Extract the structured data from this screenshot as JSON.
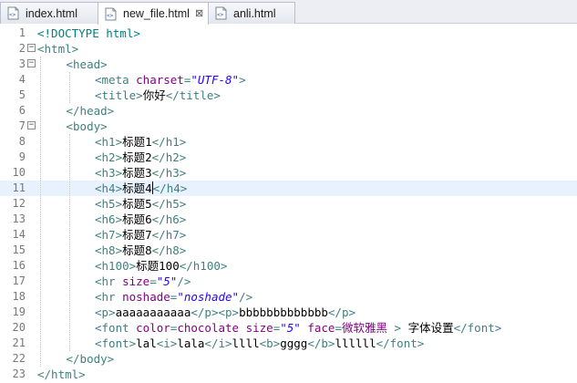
{
  "tabs": [
    {
      "label": "index.html",
      "active": false
    },
    {
      "label": "new_file.html",
      "active": true,
      "close": "⊠"
    },
    {
      "label": "anli.html",
      "active": false
    }
  ],
  "editor": {
    "current_line": 11,
    "lines": [
      {
        "n": "1",
        "indent": 0,
        "parts": [
          [
            "d",
            "<!DOCTYPE html>"
          ]
        ]
      },
      {
        "n": "2",
        "indent": 0,
        "fold": "−",
        "parts": [
          [
            "t",
            "<html>"
          ]
        ]
      },
      {
        "n": "3",
        "indent": 1,
        "fold": "−",
        "parts": [
          [
            "t",
            "<head>"
          ]
        ]
      },
      {
        "n": "4",
        "indent": 2,
        "parts": [
          [
            "t",
            "<meta "
          ],
          [
            "a",
            "charset"
          ],
          [
            "t",
            "="
          ],
          [
            "v",
            "\"UTF-8\""
          ],
          [
            "t",
            ">"
          ]
        ]
      },
      {
        "n": "5",
        "indent": 2,
        "parts": [
          [
            "t",
            "<title>"
          ],
          [
            "x",
            "你好"
          ],
          [
            "t",
            "</title>"
          ]
        ]
      },
      {
        "n": "6",
        "indent": 1,
        "parts": [
          [
            "t",
            "</head>"
          ]
        ]
      },
      {
        "n": "7",
        "indent": 1,
        "fold": "−",
        "parts": [
          [
            "t",
            "<body>"
          ]
        ]
      },
      {
        "n": "8",
        "indent": 2,
        "parts": [
          [
            "t",
            "<h1>"
          ],
          [
            "x",
            "标题1"
          ],
          [
            "t",
            "</h1>"
          ]
        ]
      },
      {
        "n": "9",
        "indent": 2,
        "parts": [
          [
            "t",
            "<h2>"
          ],
          [
            "x",
            "标题2"
          ],
          [
            "t",
            "</h2>"
          ]
        ]
      },
      {
        "n": "10",
        "indent": 2,
        "parts": [
          [
            "t",
            "<h3>"
          ],
          [
            "x",
            "标题3"
          ],
          [
            "t",
            "</h3>"
          ]
        ]
      },
      {
        "n": "11",
        "indent": 2,
        "caret_after": 1,
        "parts": [
          [
            "t",
            "<h4>"
          ],
          [
            "x",
            "标题4"
          ],
          [
            "t",
            "</h4>"
          ]
        ]
      },
      {
        "n": "12",
        "indent": 2,
        "parts": [
          [
            "t",
            "<h5>"
          ],
          [
            "x",
            "标题5"
          ],
          [
            "t",
            "</h5>"
          ]
        ]
      },
      {
        "n": "13",
        "indent": 2,
        "parts": [
          [
            "t",
            "<h6>"
          ],
          [
            "x",
            "标题6"
          ],
          [
            "t",
            "</h6>"
          ]
        ]
      },
      {
        "n": "14",
        "indent": 2,
        "parts": [
          [
            "t",
            "<h7>"
          ],
          [
            "x",
            "标题7"
          ],
          [
            "t",
            "</h7>"
          ]
        ]
      },
      {
        "n": "15",
        "indent": 2,
        "parts": [
          [
            "t",
            "<h8>"
          ],
          [
            "x",
            "标题8"
          ],
          [
            "t",
            "</h8>"
          ]
        ]
      },
      {
        "n": "16",
        "indent": 2,
        "parts": [
          [
            "t",
            "<h100>"
          ],
          [
            "x",
            "标题100"
          ],
          [
            "t",
            "</h100>"
          ]
        ]
      },
      {
        "n": "17",
        "indent": 2,
        "parts": [
          [
            "t",
            "<hr "
          ],
          [
            "a",
            "size"
          ],
          [
            "t",
            "="
          ],
          [
            "v",
            "\"5\""
          ],
          [
            "t",
            "/>"
          ]
        ]
      },
      {
        "n": "18",
        "indent": 2,
        "parts": [
          [
            "t",
            "<hr "
          ],
          [
            "a",
            "noshade"
          ],
          [
            "t",
            "="
          ],
          [
            "v",
            "\"noshade\""
          ],
          [
            "t",
            "/>"
          ]
        ]
      },
      {
        "n": "19",
        "indent": 2,
        "parts": [
          [
            "t",
            "<p>"
          ],
          [
            "x",
            "aaaaaaaaaaa"
          ],
          [
            "t",
            "</p><p>"
          ],
          [
            "x",
            "bbbbbbbbbbbbb"
          ],
          [
            "t",
            "</p>"
          ]
        ]
      },
      {
        "n": "20",
        "indent": 2,
        "parts": [
          [
            "t",
            "<font "
          ],
          [
            "a",
            "color"
          ],
          [
            "t",
            "="
          ],
          [
            "a",
            "chocolate"
          ],
          [
            "t",
            " "
          ],
          [
            "a",
            "size"
          ],
          [
            "t",
            "="
          ],
          [
            "v",
            "\"5\""
          ],
          [
            "t",
            " "
          ],
          [
            "a",
            "face"
          ],
          [
            "t",
            "="
          ],
          [
            "a",
            "微软雅黑"
          ],
          [
            "t",
            " > "
          ],
          [
            "x",
            "字体设置"
          ],
          [
            "t",
            "</font>"
          ]
        ]
      },
      {
        "n": "21",
        "indent": 2,
        "parts": [
          [
            "t",
            "<font>"
          ],
          [
            "x",
            "lal"
          ],
          [
            "t",
            "<i>"
          ],
          [
            "x",
            "lala"
          ],
          [
            "t",
            "</i>"
          ],
          [
            "x",
            "llll"
          ],
          [
            "t",
            "<b>"
          ],
          [
            "x",
            "gggg"
          ],
          [
            "t",
            "</b>"
          ],
          [
            "x",
            "llllll"
          ],
          [
            "t",
            "</font>"
          ]
        ]
      },
      {
        "n": "22",
        "indent": 1,
        "parts": [
          [
            "t",
            "</body>"
          ]
        ]
      },
      {
        "n": "23",
        "indent": 0,
        "parts": [
          [
            "t",
            "</html>"
          ]
        ]
      }
    ]
  }
}
